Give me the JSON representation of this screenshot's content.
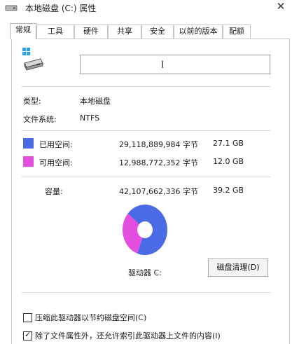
{
  "window": {
    "title": "本地磁盘 (C:) 属性",
    "close_glyph": "✕"
  },
  "tabs": [
    {
      "label": "常规",
      "active": true
    },
    {
      "label": "工具",
      "active": false
    },
    {
      "label": "硬件",
      "active": false
    },
    {
      "label": "共享",
      "active": false
    },
    {
      "label": "安全",
      "active": false
    },
    {
      "label": "以前的版本",
      "active": false
    },
    {
      "label": "配额",
      "active": false
    }
  ],
  "general": {
    "drive_name_value": "",
    "type_label": "类型:",
    "type_value": "本地磁盘",
    "fs_label": "文件系统:",
    "fs_value": "NTFS",
    "used": {
      "label": "已用空间:",
      "bytes": "29,118,889,984 字节",
      "size": "27.1 GB",
      "color": "#4b6ae6"
    },
    "free": {
      "label": "可用空间:",
      "bytes": "12,988,772,352 字节",
      "size": "12.0 GB",
      "color": "#e44ee0"
    },
    "capacity": {
      "label": "容量:",
      "bytes": "42,107,662,336 字节",
      "size": "39.2 GB"
    },
    "drive_label": "驱动器 C:",
    "cleanup_button": "磁盘清理(D)",
    "compress_checkbox": {
      "label": "压缩此驱动器以节约磁盘空间(C)",
      "checked": false
    },
    "index_checkbox": {
      "label": "除了文件属性外，还允许索引此驱动器上文件的内容(I)",
      "checked": true
    }
  },
  "chart_data": {
    "type": "pie",
    "series": [
      {
        "name": "已用空间",
        "value": 27.1,
        "color": "#4b6ae6"
      },
      {
        "name": "可用空间",
        "value": 12.0,
        "color": "#e44ee0"
      }
    ]
  },
  "icons": {
    "title_icon": "drive-icon",
    "drive_icon": "windows-drive-icon",
    "check_glyph": "✓",
    "ibeam_glyph": "I"
  }
}
